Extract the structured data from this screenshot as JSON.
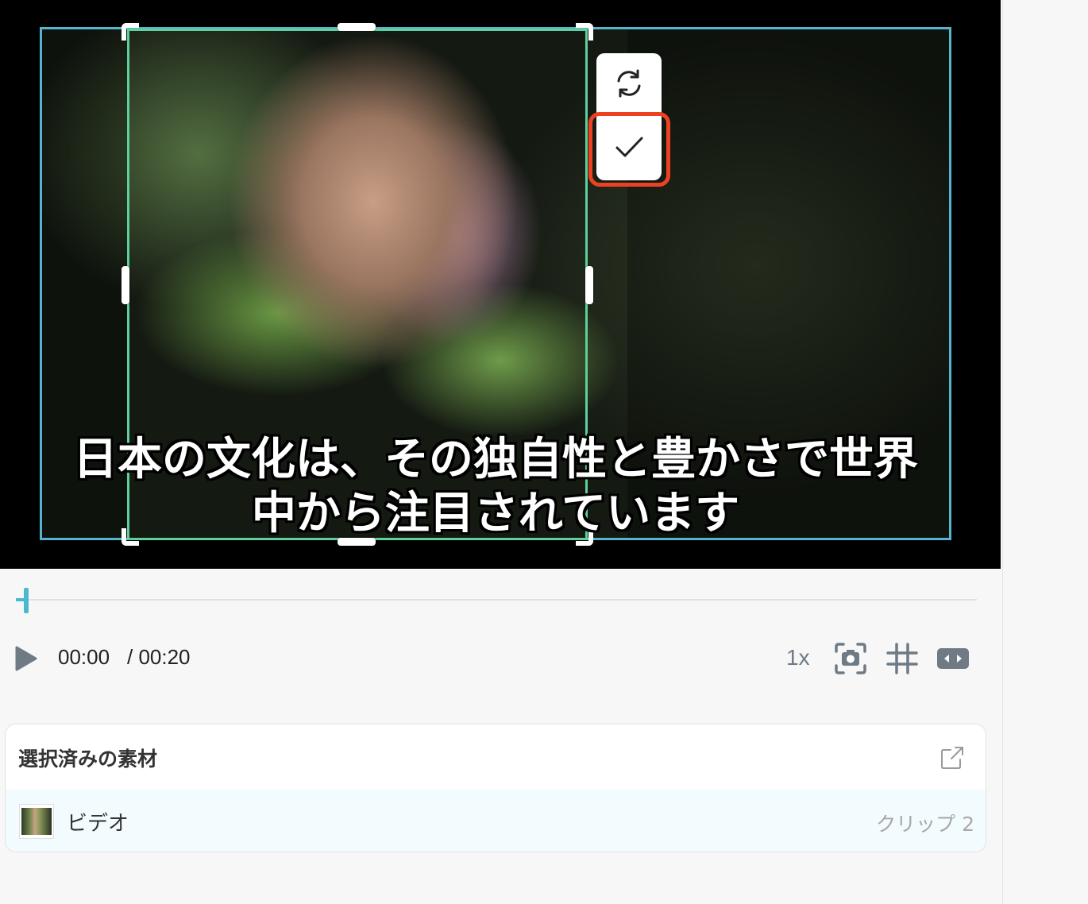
{
  "preview": {
    "subtitle_line1": "日本の文化は、その独自性と豊かさで世界",
    "subtitle_line2": "中から注目されています",
    "crop_tools": {
      "rotate_icon": "rotate-icon",
      "confirm_icon": "check-icon"
    },
    "colors": {
      "outer_box": "#56b4cf",
      "crop_box": "#5fcf9c",
      "highlight": "#ee4122"
    }
  },
  "timeline": {
    "progress": 0
  },
  "controls": {
    "time_current": "00:00",
    "time_total": "/ 00:20",
    "speed": "1x",
    "icons": [
      "play-icon",
      "screenshot-icon",
      "grid-icon",
      "aspect-ratio-icon"
    ]
  },
  "assets": {
    "title": "選択済みの素材",
    "items": [
      {
        "name": "ビデオ",
        "clip": "クリップ 2"
      }
    ]
  }
}
